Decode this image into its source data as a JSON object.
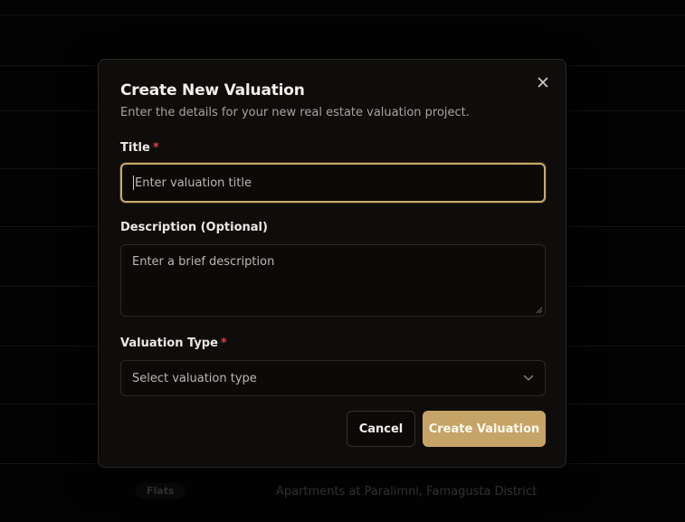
{
  "background": {
    "row_badge": "Flats",
    "row_location": "Apartments at Paralimni, Famagusta District"
  },
  "dialog": {
    "title": "Create New Valuation",
    "subtitle": "Enter the details for your new real estate valuation project.",
    "close_icon": "close-icon",
    "fields": {
      "title": {
        "label": "Title",
        "required_mark": "*",
        "value": "",
        "placeholder": "Enter valuation title"
      },
      "description": {
        "label": "Description (Optional)",
        "value": "",
        "placeholder": "Enter a brief description"
      },
      "valuation_type": {
        "label": "Valuation Type",
        "required_mark": "*",
        "selected": "Select valuation type",
        "icon": "chevron-down-icon"
      }
    },
    "buttons": {
      "cancel": "Cancel",
      "create": "Create Valuation"
    }
  },
  "colors": {
    "accent": "#c6a467",
    "required": "#e0443c",
    "dialog_bg": "#0e0d0c"
  }
}
